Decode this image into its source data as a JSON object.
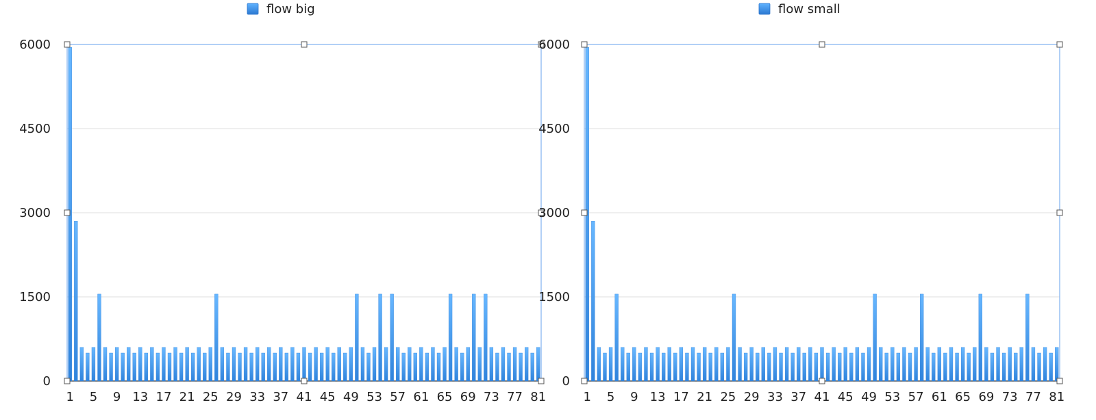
{
  "chart_data": [
    {
      "type": "bar",
      "title": "",
      "xlabel": "",
      "ylabel": "",
      "ylim": [
        0,
        6000
      ],
      "yticks": [
        "0",
        "1500",
        "3000",
        "4500",
        "6000"
      ],
      "xtick_labels": [
        "1",
        "5",
        "9",
        "13",
        "17",
        "21",
        "25",
        "29",
        "33",
        "37",
        "41",
        "45",
        "49",
        "53",
        "57",
        "61",
        "65",
        "69",
        "73",
        "77",
        "81"
      ],
      "grid": true,
      "legend": "top-center",
      "series": [
        {
          "name": "flow big",
          "color": "#4ea5f3",
          "values": [
            5950,
            2850,
            600,
            500,
            600,
            1550,
            600,
            500,
            600,
            500,
            600,
            500,
            600,
            500,
            600,
            500,
            600,
            500,
            600,
            500,
            600,
            500,
            600,
            500,
            600,
            1550,
            600,
            500,
            600,
            500,
            600,
            500,
            600,
            500,
            600,
            500,
            600,
            500,
            600,
            500,
            600,
            500,
            600,
            500,
            600,
            500,
            600,
            500,
            600,
            1550,
            600,
            500,
            600,
            1550,
            600,
            1550,
            600,
            500,
            600,
            500,
            600,
            500,
            600,
            500,
            600,
            1550,
            600,
            500,
            600,
            1550,
            600,
            1550,
            600,
            500,
            600,
            500,
            600,
            500,
            600,
            500,
            600
          ]
        }
      ]
    },
    {
      "type": "bar",
      "title": "",
      "xlabel": "",
      "ylabel": "",
      "ylim": [
        0,
        6000
      ],
      "yticks": [
        "0",
        "1500",
        "3000",
        "4500",
        "6000"
      ],
      "xtick_labels": [
        "1",
        "5",
        "9",
        "13",
        "17",
        "21",
        "25",
        "29",
        "33",
        "37",
        "41",
        "45",
        "49",
        "53",
        "57",
        "61",
        "65",
        "69",
        "73",
        "77",
        "81"
      ],
      "grid": true,
      "legend": "top-center",
      "series": [
        {
          "name": "flow small",
          "color": "#4ea5f3",
          "values": [
            5950,
            2850,
            600,
            500,
            600,
            1550,
            600,
            500,
            600,
            500,
            600,
            500,
            600,
            500,
            600,
            500,
            600,
            500,
            600,
            500,
            600,
            500,
            600,
            500,
            600,
            1550,
            600,
            500,
            600,
            500,
            600,
            500,
            600,
            500,
            600,
            500,
            600,
            500,
            600,
            500,
            600,
            500,
            600,
            500,
            600,
            500,
            600,
            500,
            600,
            1550,
            600,
            500,
            600,
            500,
            600,
            500,
            600,
            1550,
            600,
            500,
            600,
            500,
            600,
            500,
            600,
            500,
            600,
            1550,
            600,
            500,
            600,
            500,
            600,
            500,
            600,
            1550,
            600,
            500,
            600,
            500,
            600
          ]
        }
      ]
    }
  ]
}
